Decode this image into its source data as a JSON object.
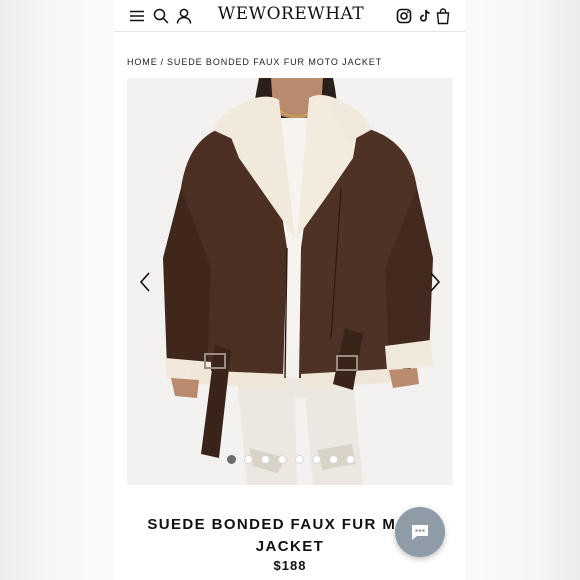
{
  "header": {
    "logo": "WEWOREWHAT",
    "icons": [
      "menu-icon",
      "search-icon",
      "account-icon",
      "instagram-icon",
      "tiktok-icon",
      "cart-icon"
    ]
  },
  "breadcrumb": {
    "home": "HOME",
    "separator": "/",
    "current": "SUEDE BONDED FAUX FUR MOTO JACKET"
  },
  "gallery": {
    "image_count": 8,
    "active_index": 0,
    "prev_icon": "chevron-left-icon",
    "next_icon": "chevron-right-icon"
  },
  "product": {
    "title_line1": "SUEDE BONDED FAUX FUR MOTO",
    "title_line2": "JACKET",
    "price": "$188"
  },
  "chat": {
    "icon": "chat-icon"
  },
  "colors": {
    "jacket_brown": "#4a2f22",
    "shearling_cream": "#f1e9dc",
    "accent_dot": "#6b6b6b",
    "chat_button": "#8f9ba6"
  }
}
